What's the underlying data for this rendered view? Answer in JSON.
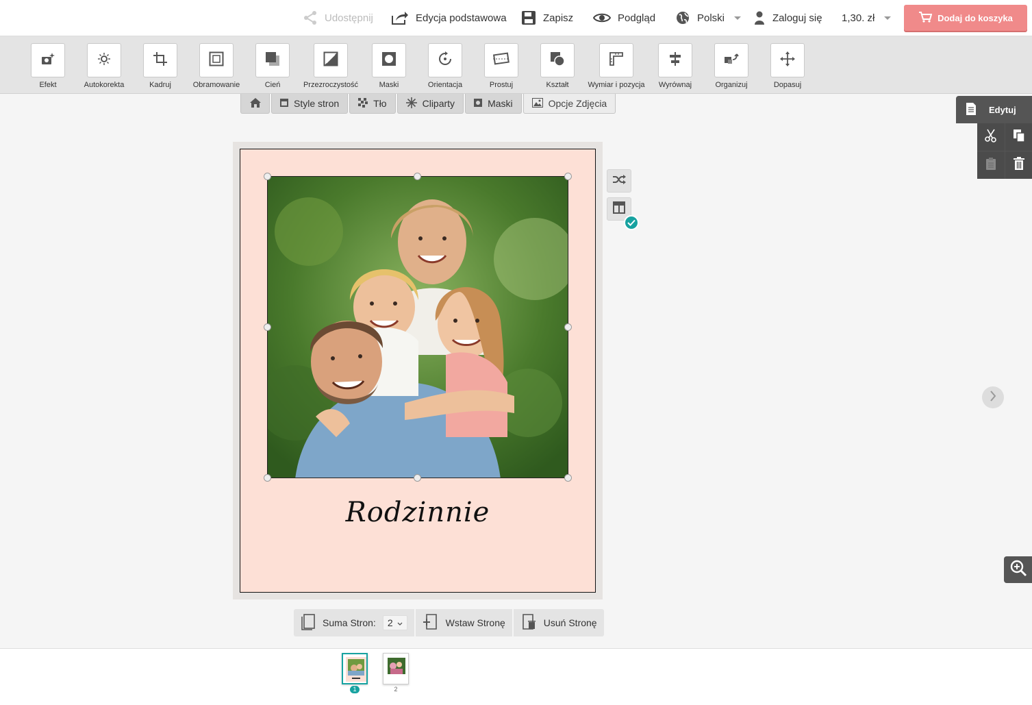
{
  "topbar": {
    "share_label": "Udostępnij",
    "basic_edit_label": "Edycja podstawowa",
    "save_label": "Zapisz",
    "preview_label": "Podgląd",
    "language_label": "Polski",
    "login_label": "Zaloguj się",
    "price_label": "1,30. zł",
    "cart_label": "Dodaj do koszyka",
    "cart_color": "#f08a8a"
  },
  "tools": [
    {
      "label": "Efekt",
      "icon": "effect-icon"
    },
    {
      "label": "Autokorekta",
      "icon": "autocorrect-icon"
    },
    {
      "label": "Kadruj",
      "icon": "crop-icon"
    },
    {
      "label": "Obramowanie",
      "icon": "border-icon"
    },
    {
      "label": "Cień",
      "icon": "shadow-icon"
    },
    {
      "label": "Przezroczystość",
      "icon": "transparency-icon"
    },
    {
      "label": "Maski",
      "icon": "mask-icon"
    },
    {
      "label": "Orientacja",
      "icon": "rotate-icon"
    },
    {
      "label": "Prostuj",
      "icon": "straighten-icon"
    },
    {
      "label": "Kształt",
      "icon": "shape-icon"
    },
    {
      "label": "Wymiar i pozycja",
      "icon": "dimension-icon"
    },
    {
      "label": "Wyrównaj",
      "icon": "align-icon"
    },
    {
      "label": "Organizuj",
      "icon": "arrange-icon"
    },
    {
      "label": "Dopasuj",
      "icon": "fit-icon"
    }
  ],
  "tabs": {
    "page_styles": "Style stron",
    "background": "Tło",
    "cliparts": "Cliparty",
    "masks": "Maski",
    "photo_options": "Opcje Zdjęcia"
  },
  "edit_panel": {
    "label": "Edytuj"
  },
  "page": {
    "caption": "Rodzinnie",
    "background_color": "#fde0d6"
  },
  "page_controls": {
    "total_pages_label": "Suma Stron:",
    "total_pages_value": "2",
    "insert_label": "Wstaw Stronę",
    "delete_label": "Usuń Stronę"
  },
  "thumbnails": [
    {
      "number": "1",
      "active": true
    },
    {
      "number": "2",
      "active": false
    }
  ],
  "accent_color": "#17a2a0"
}
